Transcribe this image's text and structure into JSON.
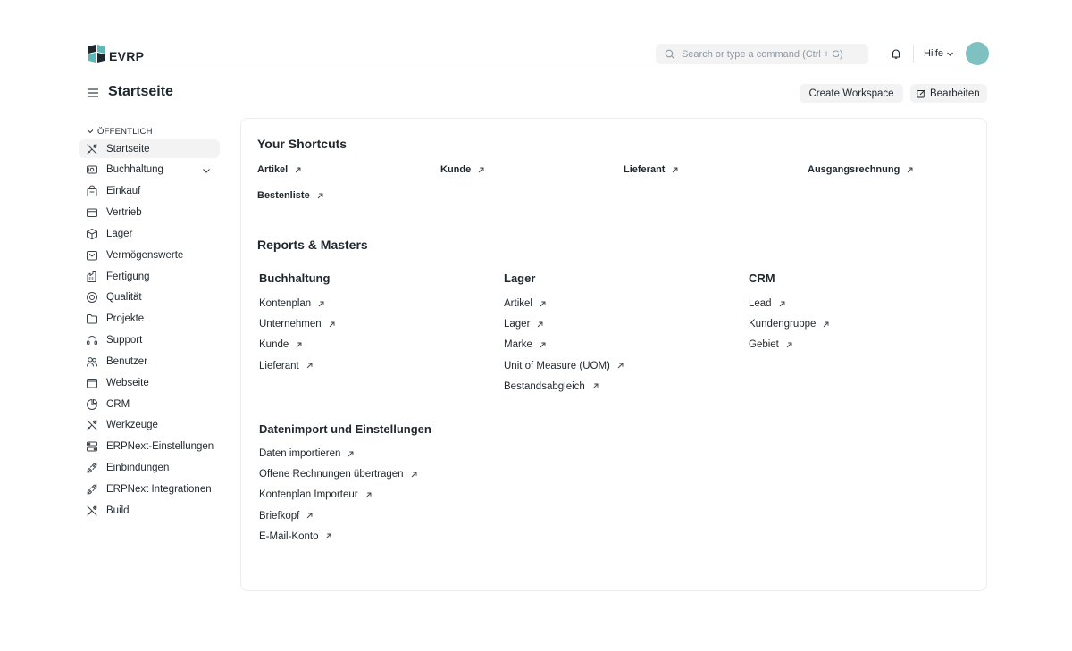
{
  "navbar": {
    "logo_text": "EVRP",
    "search_placeholder": "Search or type a command (Ctrl + G)",
    "help_label": "Hilfe",
    "avatar_color": "#7fc1c1"
  },
  "page_head": {
    "title": "Startseite",
    "create_workspace_label": "Create Workspace",
    "edit_label": "Bearbeiten"
  },
  "sidebar": {
    "section_label": "ÖFFENTLICH",
    "items": [
      {
        "label": "Startseite",
        "icon": "tools-icon",
        "active": true
      },
      {
        "label": "Buchhaltung",
        "icon": "accounting-icon",
        "expandable": true
      },
      {
        "label": "Einkauf",
        "icon": "shopping-bag-icon"
      },
      {
        "label": "Vertrieb",
        "icon": "card-icon"
      },
      {
        "label": "Lager",
        "icon": "package-icon"
      },
      {
        "label": "Vermögenswerte",
        "icon": "assets-icon"
      },
      {
        "label": "Fertigung",
        "icon": "factory-icon"
      },
      {
        "label": "Qualität",
        "icon": "quality-icon"
      },
      {
        "label": "Projekte",
        "icon": "folder-icon"
      },
      {
        "label": "Support",
        "icon": "headset-icon"
      },
      {
        "label": "Benutzer",
        "icon": "users-icon"
      },
      {
        "label": "Webseite",
        "icon": "browser-icon"
      },
      {
        "label": "CRM",
        "icon": "crm-icon"
      },
      {
        "label": "Werkzeuge",
        "icon": "tools-icon"
      },
      {
        "label": "ERPNext-Einstellungen",
        "icon": "settings-icon"
      },
      {
        "label": "Einbindungen",
        "icon": "integration-icon"
      },
      {
        "label": "ERPNext Integrationen",
        "icon": "integration-icon"
      },
      {
        "label": "Build",
        "icon": "tools-icon"
      }
    ]
  },
  "shortcuts": {
    "heading": "Your Shortcuts",
    "items": [
      "Artikel",
      "Kunde",
      "Lieferant",
      "Ausgangsrechnung",
      "Bestenliste"
    ]
  },
  "reports": {
    "heading": "Reports & Masters",
    "groups": [
      {
        "title": "Buchhaltung",
        "links": [
          "Kontenplan",
          "Unternehmen",
          "Kunde",
          "Lieferant"
        ]
      },
      {
        "title": "Lager",
        "links": [
          "Artikel",
          "Lager",
          "Marke",
          "Unit of Measure (UOM)",
          "Bestandsabgleich"
        ]
      },
      {
        "title": "CRM",
        "links": [
          "Lead",
          "Kundengruppe",
          "Gebiet"
        ]
      },
      {
        "title": "Datenimport und Einstellungen",
        "links": [
          "Daten importieren",
          "Offene Rechnungen übertragen",
          "Kontenplan Importeur",
          "Briefkopf",
          "E-Mail-Konto"
        ]
      }
    ]
  }
}
